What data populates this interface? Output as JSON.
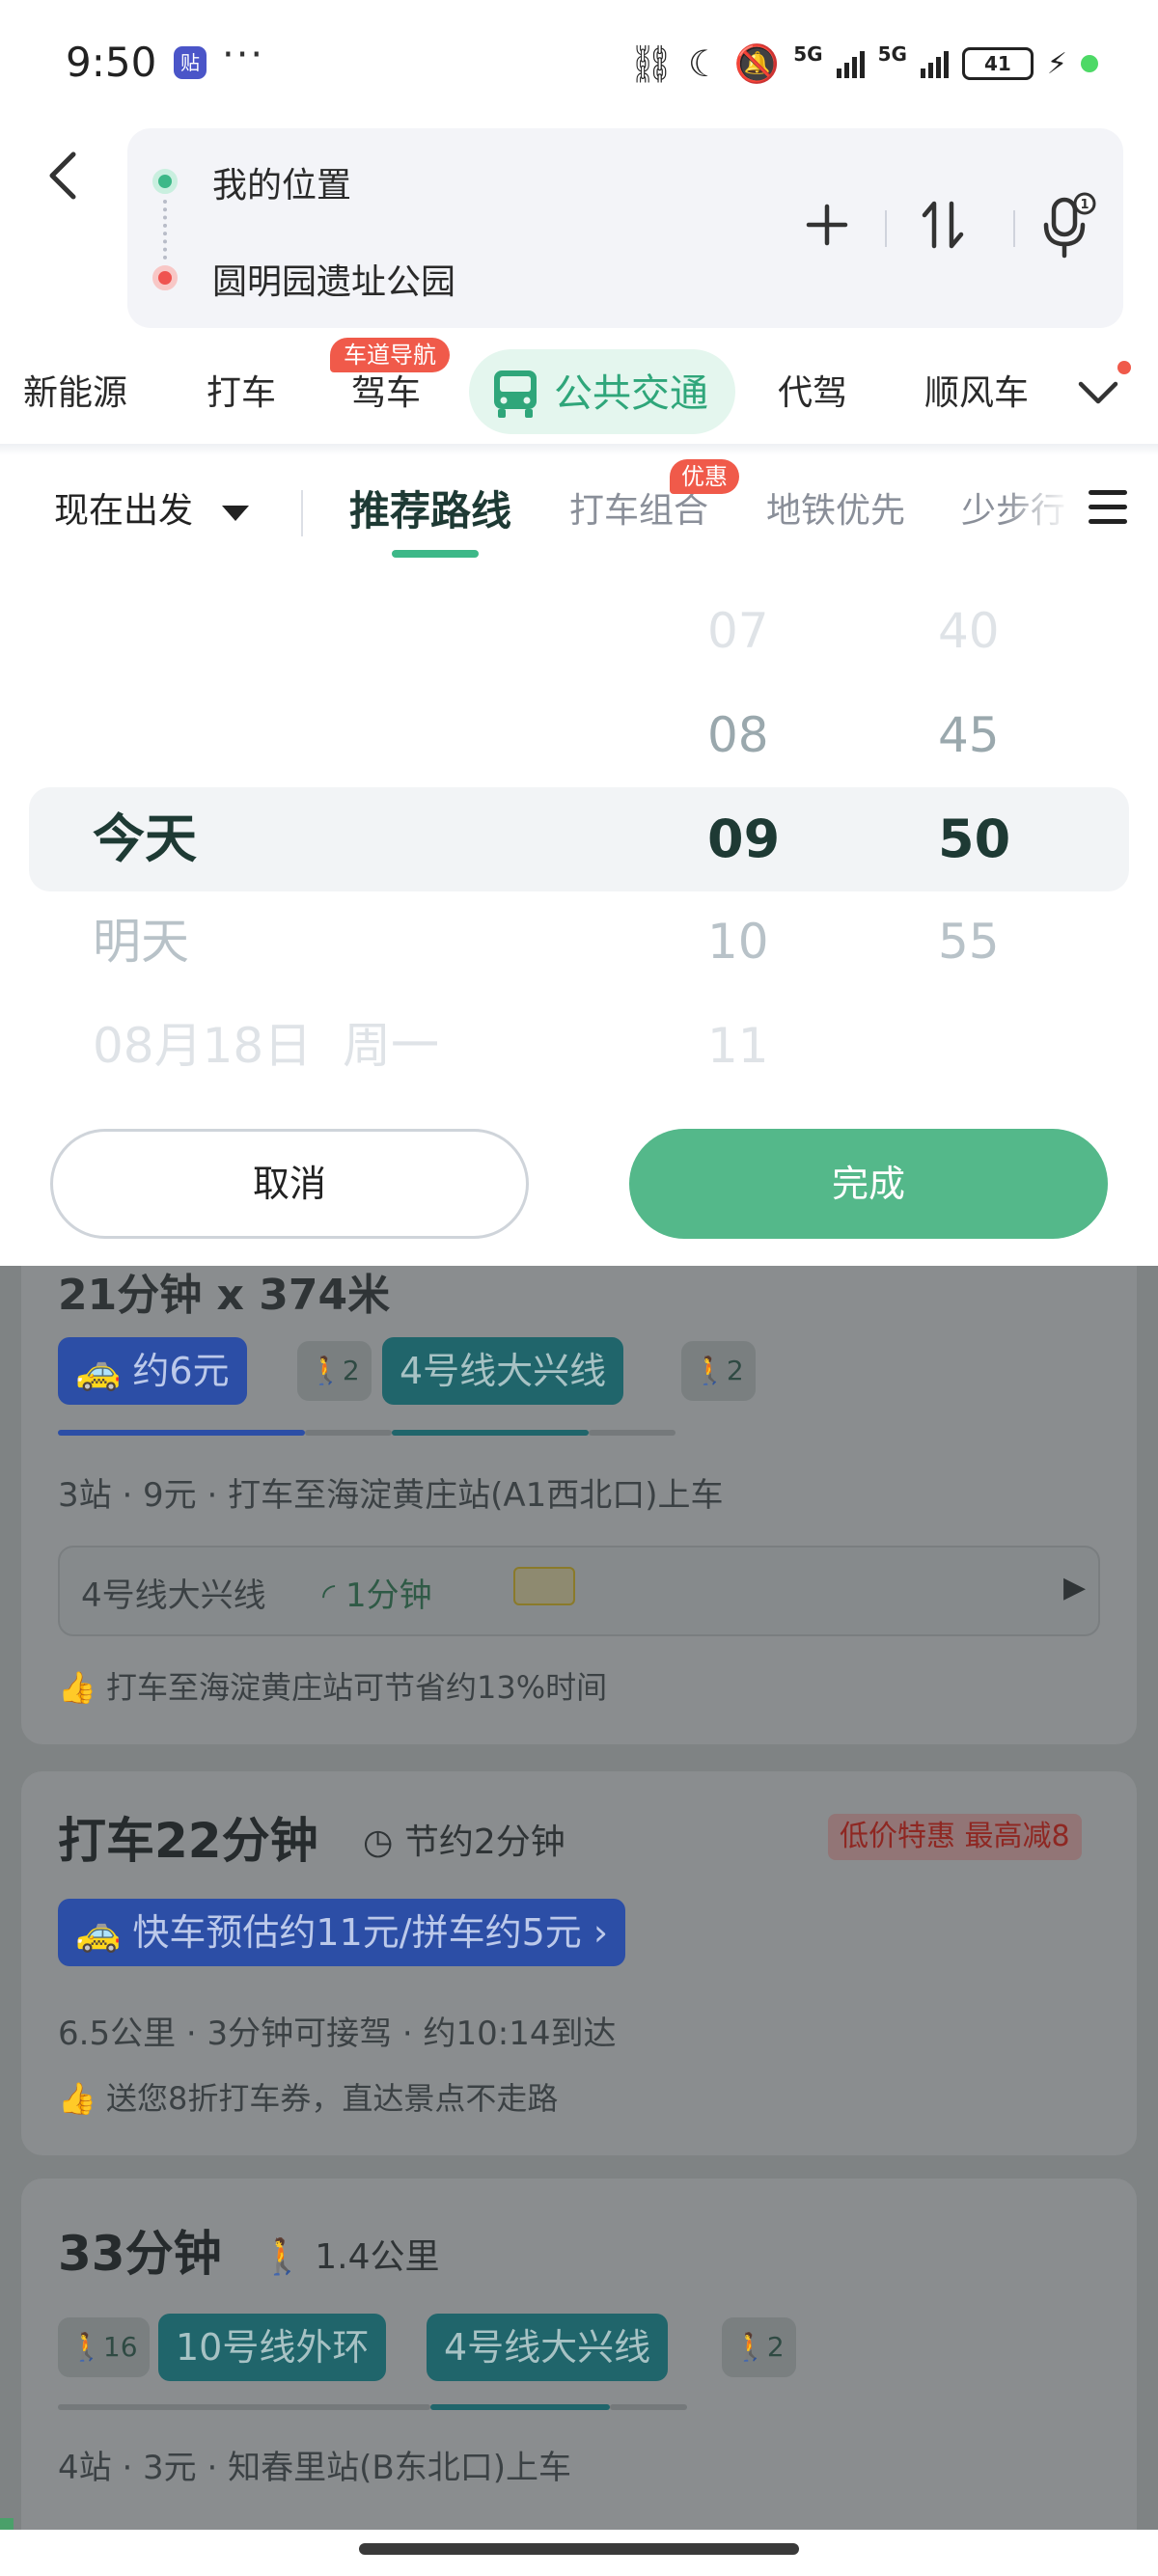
{
  "status_bar": {
    "time": "9:50",
    "app_badge": "贴",
    "more": "···",
    "network": "5G",
    "network2": "5G",
    "battery": "41"
  },
  "route": {
    "origin": "我的位置",
    "destination": "圆明园遗址公园"
  },
  "mode_tabs": [
    {
      "label": "新能源"
    },
    {
      "label": "打车"
    },
    {
      "label": "驾车",
      "badge": "车道导航"
    },
    {
      "label": "公共交通"
    },
    {
      "label": "代驾"
    },
    {
      "label": "顺风车"
    }
  ],
  "sub_tabs": {
    "depart": "现在出发",
    "items": [
      "推荐路线",
      "打车组合",
      "地铁优先",
      "少步行"
    ],
    "badge": "优惠"
  },
  "picker": {
    "days": [
      "今天",
      "明天",
      "08月18日  周一"
    ],
    "hours": [
      "07",
      "08",
      "09",
      "10",
      "11"
    ],
    "minutes": [
      "40",
      "45",
      "50",
      "55"
    ],
    "cancel": "取消",
    "done": "完成"
  },
  "results": [
    {
      "header_partial": "21分钟  ⅹ 374米",
      "taxi_pill": "约6元",
      "walk1": "2",
      "line_pill": "4号线大兴线",
      "walk2": "2",
      "info": "3站 · 9元 · 打车至海淀黄庄站(A1西北口)上车",
      "subline": "4号线大兴线",
      "subline_eta": "1分钟",
      "tip": "打车至海淀黄庄站可节省约13%时间"
    },
    {
      "title": "打车22分钟",
      "save": "节约2分钟",
      "badge": "低价特惠 最高减8",
      "taxi_pill": "快车预估约11元/拼车约5元 ›",
      "info": "6.5公里 · 3分钟可接驾 · 约10:14到达",
      "tip": "送您8折打车券，直达景点不走路"
    },
    {
      "title": "33分钟",
      "walk_dist": "1.4公里",
      "walk1": "16",
      "line1": "10号线外环",
      "line2": "4号线大兴线",
      "walk2": "2",
      "info": "4站 · 3元 · 知春里站(B东北口)上车"
    }
  ],
  "colors": {
    "accent": "#3db888",
    "done_button": "#54b88a",
    "badge_red": "#f05a4a"
  }
}
